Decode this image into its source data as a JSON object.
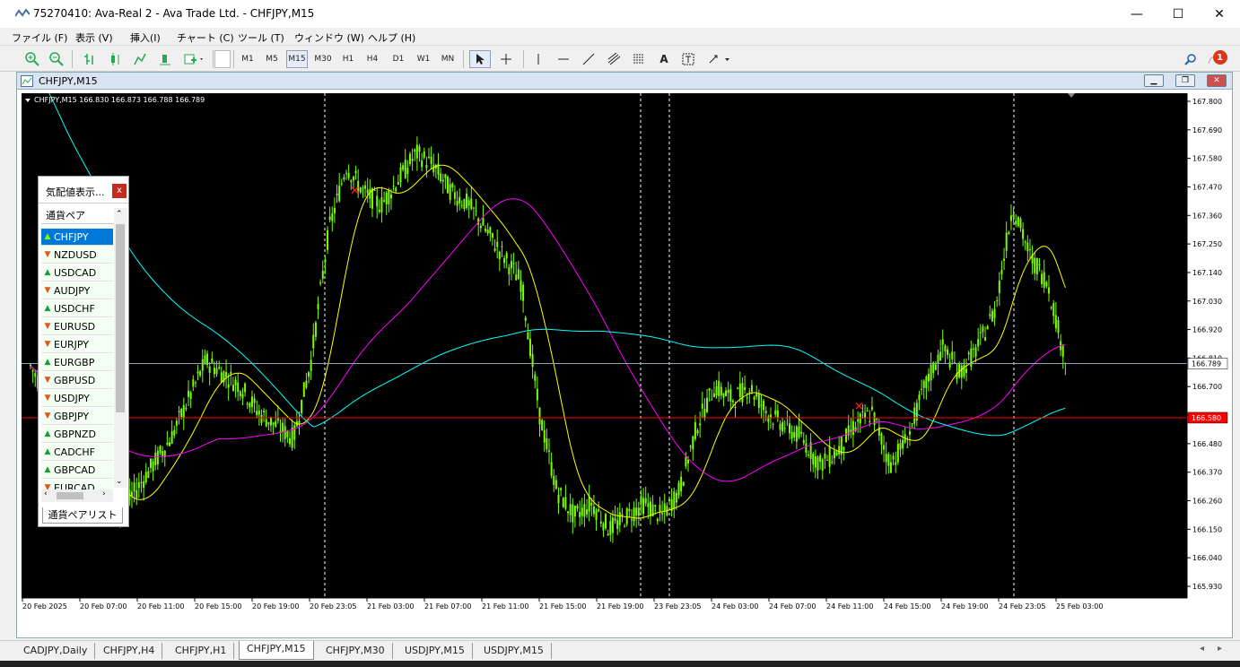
{
  "window": {
    "title": "75270410: Ava-Real 2 - Ava Trade Ltd. - CHFJPY,M15",
    "minimize": "—",
    "maximize": "☐",
    "close": "✕"
  },
  "menu": [
    "ファイル (F)",
    "表示 (V)",
    "挿入(I)",
    "チャート (C)",
    "ツール (T)",
    "ウィンドウ (W)",
    "ヘルプ (H)"
  ],
  "toolbar": {
    "timeframes": [
      "M1",
      "M5",
      "M15",
      "M30",
      "H1",
      "H4",
      "D1",
      "W1",
      "MN"
    ],
    "active_timeframe": "M15",
    "notification_count": "1"
  },
  "chart_window": {
    "title": "CHFJPY,M15"
  },
  "chart_data": {
    "type": "candlestick",
    "symbol_info": "CHFJPY,M15  166.830 166.873 166.788 166.789",
    "ylim": [
      165.93,
      167.8
    ],
    "y_ticks": [
      "167.800",
      "167.690",
      "167.580",
      "167.470",
      "167.360",
      "167.250",
      "167.140",
      "167.030",
      "166.920",
      "166.810",
      "166.700",
      "166.590",
      "166.480",
      "166.370",
      "166.260",
      "166.150",
      "166.040",
      "165.930"
    ],
    "x_ticks": [
      "20 Feb 2025",
      "20 Feb 07:00",
      "20 Feb 11:00",
      "20 Feb 15:00",
      "20 Feb 19:00",
      "20 Feb 23:05",
      "21 Feb 03:00",
      "21 Feb 07:00",
      "21 Feb 11:00",
      "21 Feb 15:00",
      "21 Feb 19:00",
      "23 Feb 23:05",
      "24 Feb 03:00",
      "24 Feb 07:00",
      "24 Feb 11:00",
      "24 Feb 15:00",
      "24 Feb 19:00",
      "24 Feb 23:05",
      "25 Feb 03:00"
    ],
    "current_price": "166.789",
    "hline_price": "166.580",
    "price_path": [
      166.78,
      166.65,
      166.5,
      166.45,
      166.3,
      166.2,
      166.3,
      166.4,
      166.5,
      166.65,
      166.8,
      166.75,
      166.7,
      166.6,
      166.55,
      166.5,
      166.8,
      167.3,
      167.55,
      167.45,
      167.4,
      167.5,
      167.6,
      167.55,
      167.45,
      167.4,
      167.3,
      167.2,
      167.1,
      166.6,
      166.3,
      166.2,
      166.25,
      166.15,
      166.2,
      166.25,
      166.2,
      166.3,
      166.55,
      166.7,
      166.65,
      166.7,
      166.6,
      166.55,
      166.5,
      166.4,
      166.45,
      166.55,
      166.6,
      166.4,
      166.5,
      166.7,
      166.85,
      166.75,
      166.85,
      167.0,
      167.4,
      167.2,
      167.1,
      166.8
    ],
    "colors": {
      "background": "#000000",
      "candles": "#7CFC00",
      "ma_fast": "#ffff00",
      "ma_slow": "#00ffff",
      "ma_mid": "#ff00ff",
      "hline": "#ff0000",
      "vlines": "#ffffff"
    }
  },
  "market_watch": {
    "title": "気配値表示...",
    "close": "x",
    "column": "通貨ペア",
    "pairs": [
      {
        "name": "CHFJPY",
        "dir": "up"
      },
      {
        "name": "NZDUSD",
        "dir": "down"
      },
      {
        "name": "USDCAD",
        "dir": "up"
      },
      {
        "name": "AUDJPY",
        "dir": "down"
      },
      {
        "name": "USDCHF",
        "dir": "up"
      },
      {
        "name": "EURUSD",
        "dir": "down"
      },
      {
        "name": "EURJPY",
        "dir": "down"
      },
      {
        "name": "EURGBP",
        "dir": "up"
      },
      {
        "name": "GBPUSD",
        "dir": "down"
      },
      {
        "name": "USDJPY",
        "dir": "down"
      },
      {
        "name": "GBPJPY",
        "dir": "down"
      },
      {
        "name": "GBPNZD",
        "dir": "up"
      },
      {
        "name": "CADCHF",
        "dir": "up"
      },
      {
        "name": "GBPCAD",
        "dir": "up"
      },
      {
        "name": "EURCAD",
        "dir": "down"
      }
    ],
    "tab": "通貨ペアリスト"
  },
  "tabs": [
    "CADJPY,Daily",
    "CHFJPY,H4",
    "CHFJPY,H1",
    "CHFJPY,M15",
    "CHFJPY,M30",
    "USDJPY,M15",
    "USDJPY,M15"
  ],
  "active_tab": "CHFJPY,M15"
}
